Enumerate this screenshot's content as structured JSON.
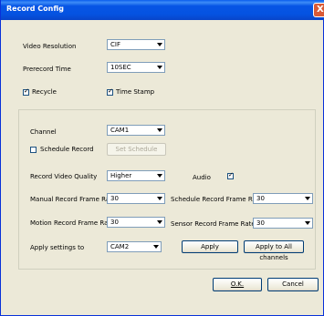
{
  "window": {
    "title": "Record Config",
    "close_glyph": "X"
  },
  "video_resolution": {
    "label": "Video Resolution",
    "value": "CIF"
  },
  "precord_time": {
    "label": "Prerecord Time",
    "value": "10SEC"
  },
  "recycle": {
    "label": "Recycle",
    "checked": true
  },
  "time_stamp": {
    "label": "Time Stamp",
    "checked": true
  },
  "channel": {
    "label": "Channel",
    "value": "CAM1"
  },
  "schedule_record": {
    "label": "Schedule Record",
    "checked": false
  },
  "set_schedule": {
    "label": "Set Schedule"
  },
  "record_video_quality": {
    "label": "Record Video Quality",
    "value": "Higher"
  },
  "audio": {
    "label": "Audio",
    "checked": true
  },
  "manual_frame_rate": {
    "label": "Manual Record Frame Rate",
    "value": "30"
  },
  "schedule_frame_rate": {
    "label": "Schedule Record Frame Rate",
    "value": "30"
  },
  "motion_frame_rate": {
    "label": "Motion Record Frame Rate",
    "value": "30"
  },
  "sensor_frame_rate": {
    "label": "Sensor Record Frame Rate",
    "value": "30"
  },
  "apply_settings_to": {
    "label": "Apply settings to",
    "value": "CAM2"
  },
  "buttons": {
    "apply": "Apply",
    "apply_all": "Apply to All channels",
    "ok": "O.K.",
    "cancel": "Cancel"
  },
  "check_mark": "✓"
}
